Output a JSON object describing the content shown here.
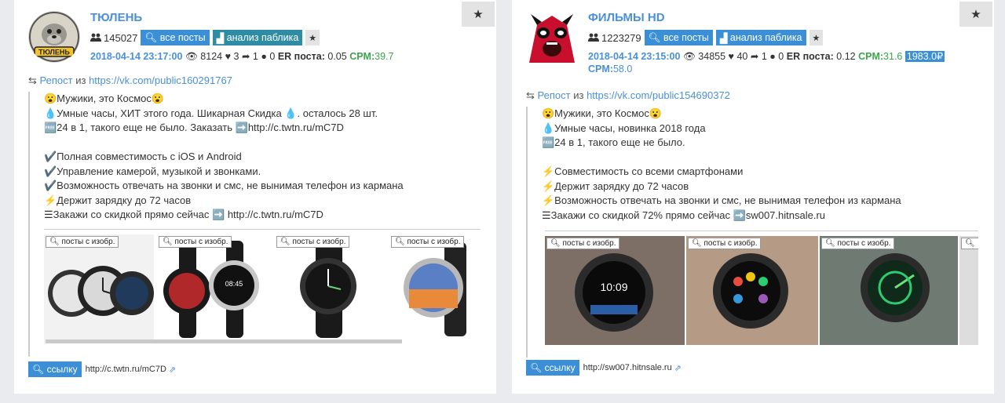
{
  "posts": [
    {
      "title": "ТЮЛЕНЬ",
      "avatar_caption": "ТЮЛЕНЬ",
      "subscribers": "145027",
      "btn_all_posts": "все посты",
      "btn_analysis": "анализ паблика",
      "date": "2018-04-14 23:17:00",
      "views": "8124",
      "likes": "3",
      "reposts": "1",
      "comments": "0",
      "er_label": "ER поста:",
      "er_value": "0.05",
      "cpm_label": "CPM:",
      "cpm_value": "39.7",
      "repost_label": "Репост",
      "repost_from": "из",
      "repost_url": "https://vk.com/public160291767",
      "text_lines": [
        "😮Мужики, это Космос😮",
        "💧Умные часы, ХИТ этого года. Шикарная Скидка 💧. осталось 28 шт.",
        "🆓24 в 1, такого еще не было. Заказать ➡️http://c.twtn.ru/mC7D",
        "",
        "✔️Полная совместимость с iOS и Android",
        "✔️Управление камерой, музыкой и звонками.",
        "✔️Возможность отвечать на звонки и смс, не вынимая телефон из кармана",
        "⚡Держит зарядку до 72 часов",
        "☰Закажи со скидкой прямо сейчас ➡️ http://c.twtn.ru/mC7D"
      ],
      "image_tag": "посты с изобр.",
      "link_button": "ссылку",
      "link_url": "http://c.twtn.ru/mC7D"
    },
    {
      "title": "ФИЛЬМЫ HD",
      "subscribers": "1223279",
      "btn_all_posts": "все посты",
      "btn_analysis": "анализ паблика",
      "date": "2018-04-14 23:15:00",
      "views": "34855",
      "likes": "40",
      "reposts": "1",
      "comments": "0",
      "er_label": "ER поста:",
      "er_value": "0.12",
      "cpm_label": "CPM:",
      "cpm_value": "31.6",
      "price_badge": "1983.0₽",
      "cpm2_label": "CPM:",
      "cpm2_value": "58.0",
      "repost_label": "Репост",
      "repost_from": "из",
      "repost_url": "https://vk.com/public154690372",
      "text_lines": [
        "😮Мужики, это Космос😮",
        "💧Умные часы, новинка 2018 года",
        "🆓24 в 1, такого еще не было.",
        "",
        "⚡Совместимость со всеми смартфонами",
        "⚡Держит зарядку до 72 часов",
        "⚡Возможность отвечать на звонки и смс, не вынимая телефон из кармана",
        "☰Закажи со скидкой 72% прямо сейчас ➡️sw007.hitnsale.ru"
      ],
      "image_tag": "посты с изобр.",
      "link_button": "ссылку",
      "link_url": "http://sw007.hitnsale.ru"
    }
  ],
  "icons": {
    "star": "star-icon",
    "people": "people-icon",
    "eye": "eye-icon",
    "heart": "heart-icon",
    "share": "share-icon",
    "comment": "comment-icon",
    "search": "search-icon",
    "chart": "chart-icon",
    "retweet": "repost-icon",
    "external": "external-link-icon"
  },
  "colors": {
    "accent_blue": "#3a8fd6",
    "teal": "#2e8ca5",
    "green": "#3aa54b",
    "title_blue": "#4a90d9"
  }
}
